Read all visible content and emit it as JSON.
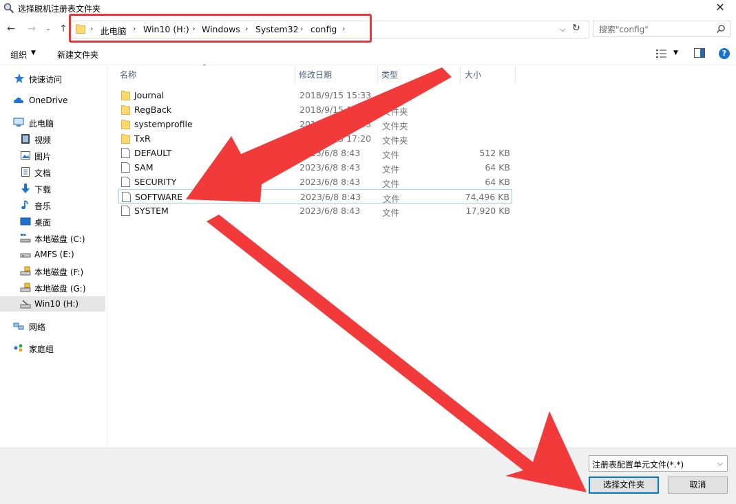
{
  "window": {
    "title": "选择脱机注册表文件夹",
    "close": "✕"
  },
  "address": {
    "crumbs": [
      "此电脑",
      "Win10 (H:)",
      "Windows",
      "System32",
      "config"
    ],
    "separator": "›"
  },
  "search": {
    "placeholder": "搜索\"config\""
  },
  "toolbar": {
    "organize": "组织",
    "new_folder": "新建文件夹"
  },
  "nav_pane": {
    "items": [
      {
        "label": "快速访问",
        "icon": "star-icon"
      },
      {
        "label": "OneDrive",
        "icon": "cloud-icon"
      },
      {
        "label": "此电脑",
        "icon": "computer-icon"
      },
      {
        "label": "视频",
        "icon": "video-icon"
      },
      {
        "label": "图片",
        "icon": "picture-icon"
      },
      {
        "label": "文档",
        "icon": "document-icon"
      },
      {
        "label": "下载",
        "icon": "download-icon"
      },
      {
        "label": "音乐",
        "icon": "music-icon"
      },
      {
        "label": "桌面",
        "icon": "desktop-icon"
      },
      {
        "label": "本地磁盘 (C:)",
        "icon": "drive-icon"
      },
      {
        "label": "AMFS (E:)",
        "icon": "drive-icon"
      },
      {
        "label": "本地磁盘 (F:)",
        "icon": "drive-icon"
      },
      {
        "label": "本地磁盘 (G:)",
        "icon": "drive-icon"
      },
      {
        "label": "Win10 (H:)",
        "icon": "drive-icon"
      },
      {
        "label": "网络",
        "icon": "network-icon"
      },
      {
        "label": "家庭组",
        "icon": "homegroup-icon"
      }
    ]
  },
  "file_list": {
    "columns": [
      "名称",
      "修改日期",
      "类型",
      "大小"
    ],
    "rows": [
      {
        "name": "Journal",
        "date": "2018/9/15 15:33",
        "type": "文件夹",
        "size": "",
        "kind": "folder"
      },
      {
        "name": "RegBack",
        "date": "2018/9/15 15:33",
        "type": "文件夹",
        "size": "",
        "kind": "folder"
      },
      {
        "name": "systemprofile",
        "date": "2018/9/15 15:33",
        "type": "文件夹",
        "size": "",
        "kind": "folder"
      },
      {
        "name": "TxR",
        "date": "2023/6/23 17:20",
        "type": "文件夹",
        "size": "",
        "kind": "folder"
      },
      {
        "name": "DEFAULT",
        "date": "2023/6/8 8:43",
        "type": "文件",
        "size": "512 KB",
        "kind": "file"
      },
      {
        "name": "SAM",
        "date": "2023/6/8 8:43",
        "type": "文件",
        "size": "64 KB",
        "kind": "file"
      },
      {
        "name": "SECURITY",
        "date": "2023/6/8 8:43",
        "type": "文件",
        "size": "64 KB",
        "kind": "file"
      },
      {
        "name": "SOFTWARE",
        "date": "2023/6/8 8:43",
        "type": "文件",
        "size": "74,496 KB",
        "kind": "file"
      },
      {
        "name": "SYSTEM",
        "date": "2023/6/8 8:43",
        "type": "文件",
        "size": "17,920 KB",
        "kind": "file"
      }
    ]
  },
  "footer": {
    "file_type": "注册表配置单元文件(*.*)",
    "select_button": "选择文件夹",
    "cancel_button": "取消"
  },
  "colors": {
    "highlight_border": "#e9363a",
    "arrow_fill": "#f23a3a",
    "accent": "#0078d7"
  }
}
